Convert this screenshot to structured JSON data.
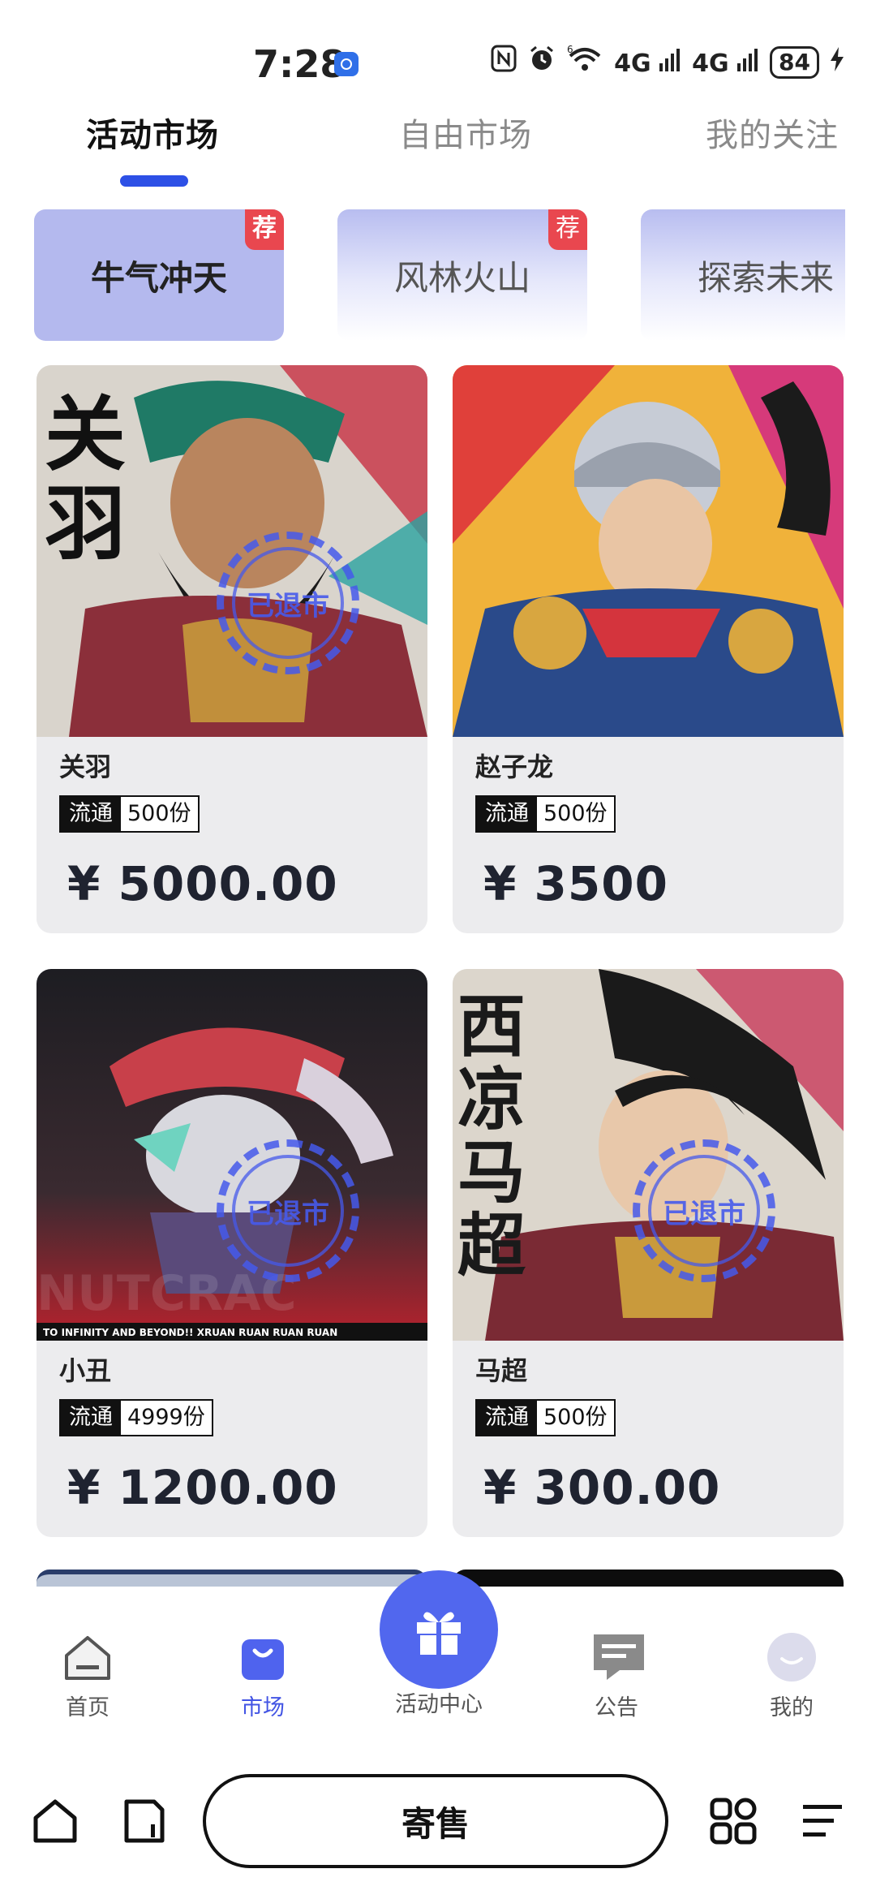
{
  "status_bar": {
    "time": "7:28",
    "signal_1": "4G",
    "signal_2": "4G",
    "wifi_label": "6",
    "battery": "84"
  },
  "tabs": [
    {
      "label": "活动市场",
      "active": true
    },
    {
      "label": "自由市场",
      "active": false
    },
    {
      "label": "我的关注",
      "active": false
    }
  ],
  "categories": [
    {
      "label": "牛气冲天",
      "badge": "荐",
      "selected": true
    },
    {
      "label": "风林火山",
      "badge": "荐",
      "selected": false
    },
    {
      "label": "探索未来",
      "badge": "",
      "selected": false
    }
  ],
  "products": [
    {
      "name": "关羽",
      "circulation_label": "流通",
      "circulation_value": "500份",
      "price": "¥ 5000.00",
      "stamp": "已退市",
      "image_text": "关羽"
    },
    {
      "name": "赵子龙",
      "circulation_label": "流通",
      "circulation_value": "500份",
      "price": "¥ 3500",
      "stamp": "",
      "image_text": ""
    },
    {
      "name": "小丑",
      "circulation_label": "流通",
      "circulation_value": "4999份",
      "price": "¥ 1200.00",
      "stamp": "已退市",
      "image_text": "TO INFINITY AND BEYOND!! XRUAN RUAN RUAN RUAN"
    },
    {
      "name": "马超",
      "circulation_label": "流通",
      "circulation_value": "500份",
      "price": "¥ 300.00",
      "stamp": "已退市",
      "image_text": "西凉马超"
    }
  ],
  "bottom_nav": {
    "home": "首页",
    "market": "市场",
    "activity_center": "活动中心",
    "announcement": "公告",
    "mine": "我的"
  },
  "system_bar": {
    "consign_label": "寄售"
  },
  "colors": {
    "accent": "#4254e4",
    "tab_indicator": "#2d50e6",
    "badge_red": "#e9474f",
    "selected_category": "#b4b9ee",
    "center_button": "#5167ee"
  }
}
